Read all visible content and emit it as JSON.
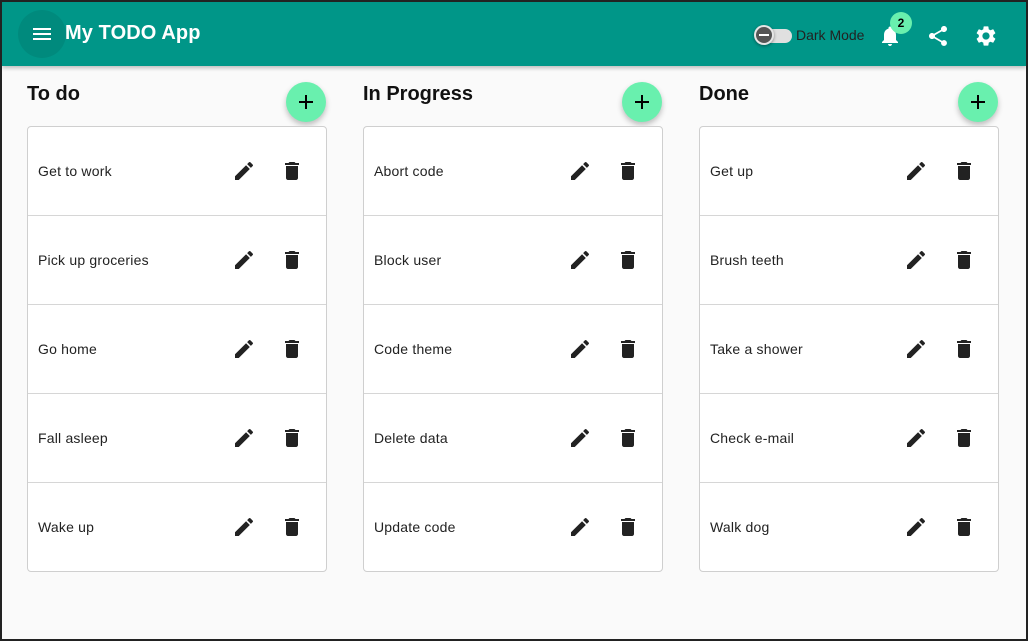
{
  "app": {
    "title": "My TODO App",
    "theme_color": "#009688",
    "accent_color": "#69f0ae"
  },
  "header": {
    "menu_icon": "menu-icon",
    "dark_mode_label": "Dark Mode",
    "dark_mode_on": false,
    "notifications_count": "2",
    "notifications_icon": "bell-icon",
    "share_icon": "share-icon",
    "settings_icon": "gear-icon"
  },
  "columns": [
    {
      "title": "To do",
      "add_icon": "plus-icon",
      "tasks": [
        {
          "text": "Get to work"
        },
        {
          "text": "Pick up groceries"
        },
        {
          "text": "Go home"
        },
        {
          "text": "Fall asleep"
        },
        {
          "text": "Wake up"
        }
      ]
    },
    {
      "title": "In Progress",
      "add_icon": "plus-icon",
      "tasks": [
        {
          "text": "Abort code"
        },
        {
          "text": "Block user"
        },
        {
          "text": "Code theme"
        },
        {
          "text": "Delete data"
        },
        {
          "text": "Update code"
        }
      ]
    },
    {
      "title": "Done",
      "add_icon": "plus-icon",
      "tasks": [
        {
          "text": "Get up"
        },
        {
          "text": "Brush teeth"
        },
        {
          "text": "Take a shower"
        },
        {
          "text": "Check e-mail"
        },
        {
          "text": "Walk dog"
        }
      ]
    }
  ],
  "task_actions": {
    "edit_icon": "pencil-icon",
    "delete_icon": "trash-icon"
  }
}
